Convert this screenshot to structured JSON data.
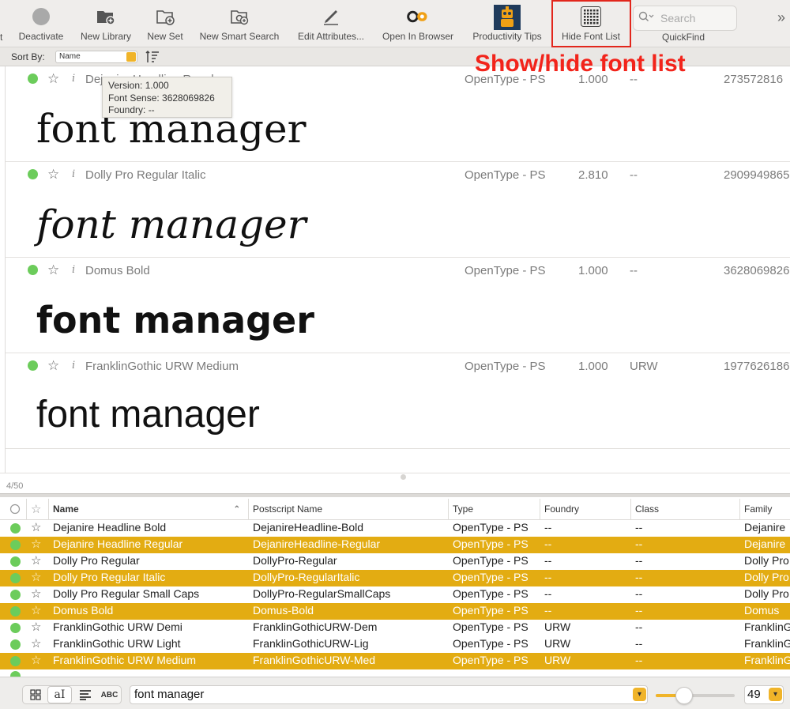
{
  "toolbar": {
    "cut_label": "t",
    "items": [
      {
        "label": "Deactivate",
        "icon": "deactivate-circle-icon"
      },
      {
        "label": "New Library",
        "icon": "folder-plus-icon"
      },
      {
        "label": "New Set",
        "icon": "folder-outline-plus-icon"
      },
      {
        "label": "New Smart Search",
        "icon": "folder-gear-icon"
      },
      {
        "label": "Edit Attributes...",
        "icon": "pencil-icon"
      },
      {
        "label": "Open In Browser",
        "icon": "browser-link-icon"
      },
      {
        "label": "Productivity Tips",
        "icon": "robot-icon"
      },
      {
        "label": "Hide Font List",
        "icon": "grid-icon"
      }
    ],
    "search_placeholder": "Search",
    "quickfind_label": "QuickFind",
    "overflow": "»"
  },
  "sortbar": {
    "label": "Sort By:",
    "value": "Name"
  },
  "annotation": "Show/hide font list",
  "tooltip": {
    "version": "Version: 1.000",
    "sense": "Font Sense: 3628069826",
    "foundry": "Foundry: --"
  },
  "preview_rows": [
    {
      "name": "Dejanire Headline Regular",
      "type": "OpenType - PS",
      "version": "1.000",
      "foundry": "--",
      "sense": "273572816",
      "sample": "font manager"
    },
    {
      "name": "Dolly Pro Regular Italic",
      "type": "OpenType - PS",
      "version": "2.810",
      "foundry": "--",
      "sense": "2909949865",
      "sample": "font manager"
    },
    {
      "name": "Domus Bold",
      "type": "OpenType - PS",
      "version": "1.000",
      "foundry": "--",
      "sense": "3628069826",
      "sample": "font manager"
    },
    {
      "name": "FranklinGothic URW Medium",
      "type": "OpenType - PS",
      "version": "1.000",
      "foundry": "URW",
      "sense": "1977626186",
      "sample": "font manager"
    }
  ],
  "count": "4/50",
  "table": {
    "headers": [
      "Name",
      "Postscript Name",
      "Type",
      "Foundry",
      "Class",
      "Family"
    ],
    "rows": [
      {
        "name": "Dejanire Headline Bold",
        "ps": "DejanireHeadline-Bold",
        "type": "OpenType - PS",
        "foundry": "--",
        "class": "--",
        "family": "Dejanire",
        "selected": false
      },
      {
        "name": "Dejanire Headline Regular",
        "ps": "DejanireHeadline-Regular",
        "type": "OpenType - PS",
        "foundry": "--",
        "class": "--",
        "family": "Dejanire",
        "selected": true
      },
      {
        "name": "Dolly Pro Regular",
        "ps": "DollyPro-Regular",
        "type": "OpenType - PS",
        "foundry": "--",
        "class": "--",
        "family": "Dolly Pro",
        "selected": false
      },
      {
        "name": "Dolly Pro Regular Italic",
        "ps": "DollyPro-RegularItalic",
        "type": "OpenType - PS",
        "foundry": "--",
        "class": "--",
        "family": "Dolly Pro",
        "selected": true
      },
      {
        "name": "Dolly Pro Regular Small Caps",
        "ps": "DollyPro-RegularSmallCaps",
        "type": "OpenType - PS",
        "foundry": "--",
        "class": "--",
        "family": "Dolly Pro",
        "selected": false
      },
      {
        "name": "Domus Bold",
        "ps": "Domus-Bold",
        "type": "OpenType - PS",
        "foundry": "--",
        "class": "--",
        "family": "Domus",
        "selected": true
      },
      {
        "name": "FranklinGothic URW Demi",
        "ps": "FranklinGothicURW-Dem",
        "type": "OpenType - PS",
        "foundry": "URW",
        "class": "--",
        "family": "FranklinG",
        "selected": false
      },
      {
        "name": "FranklinGothic URW Light",
        "ps": "FranklinGothicURW-Lig",
        "type": "OpenType - PS",
        "foundry": "URW",
        "class": "--",
        "family": "FranklinG",
        "selected": false
      },
      {
        "name": "FranklinGothic URW Medium",
        "ps": "FranklinGothicURW-Med",
        "type": "OpenType - PS",
        "foundry": "URW",
        "class": "--",
        "family": "FranklinG",
        "selected": true
      }
    ]
  },
  "bottombar": {
    "views": [
      "grid-view-icon",
      "sample-view-icon",
      "paragraph-view-icon",
      "abc-view-icon"
    ],
    "sample_label": "aI",
    "abc_label": "ABC",
    "sample_text": "font manager",
    "size": "49",
    "size_level": 0.36
  },
  "colors": {
    "accent": "#f0b429",
    "selected_row": "#e3ac12",
    "active_dot": "#6ccc5b",
    "annotation": "#f2241b"
  }
}
